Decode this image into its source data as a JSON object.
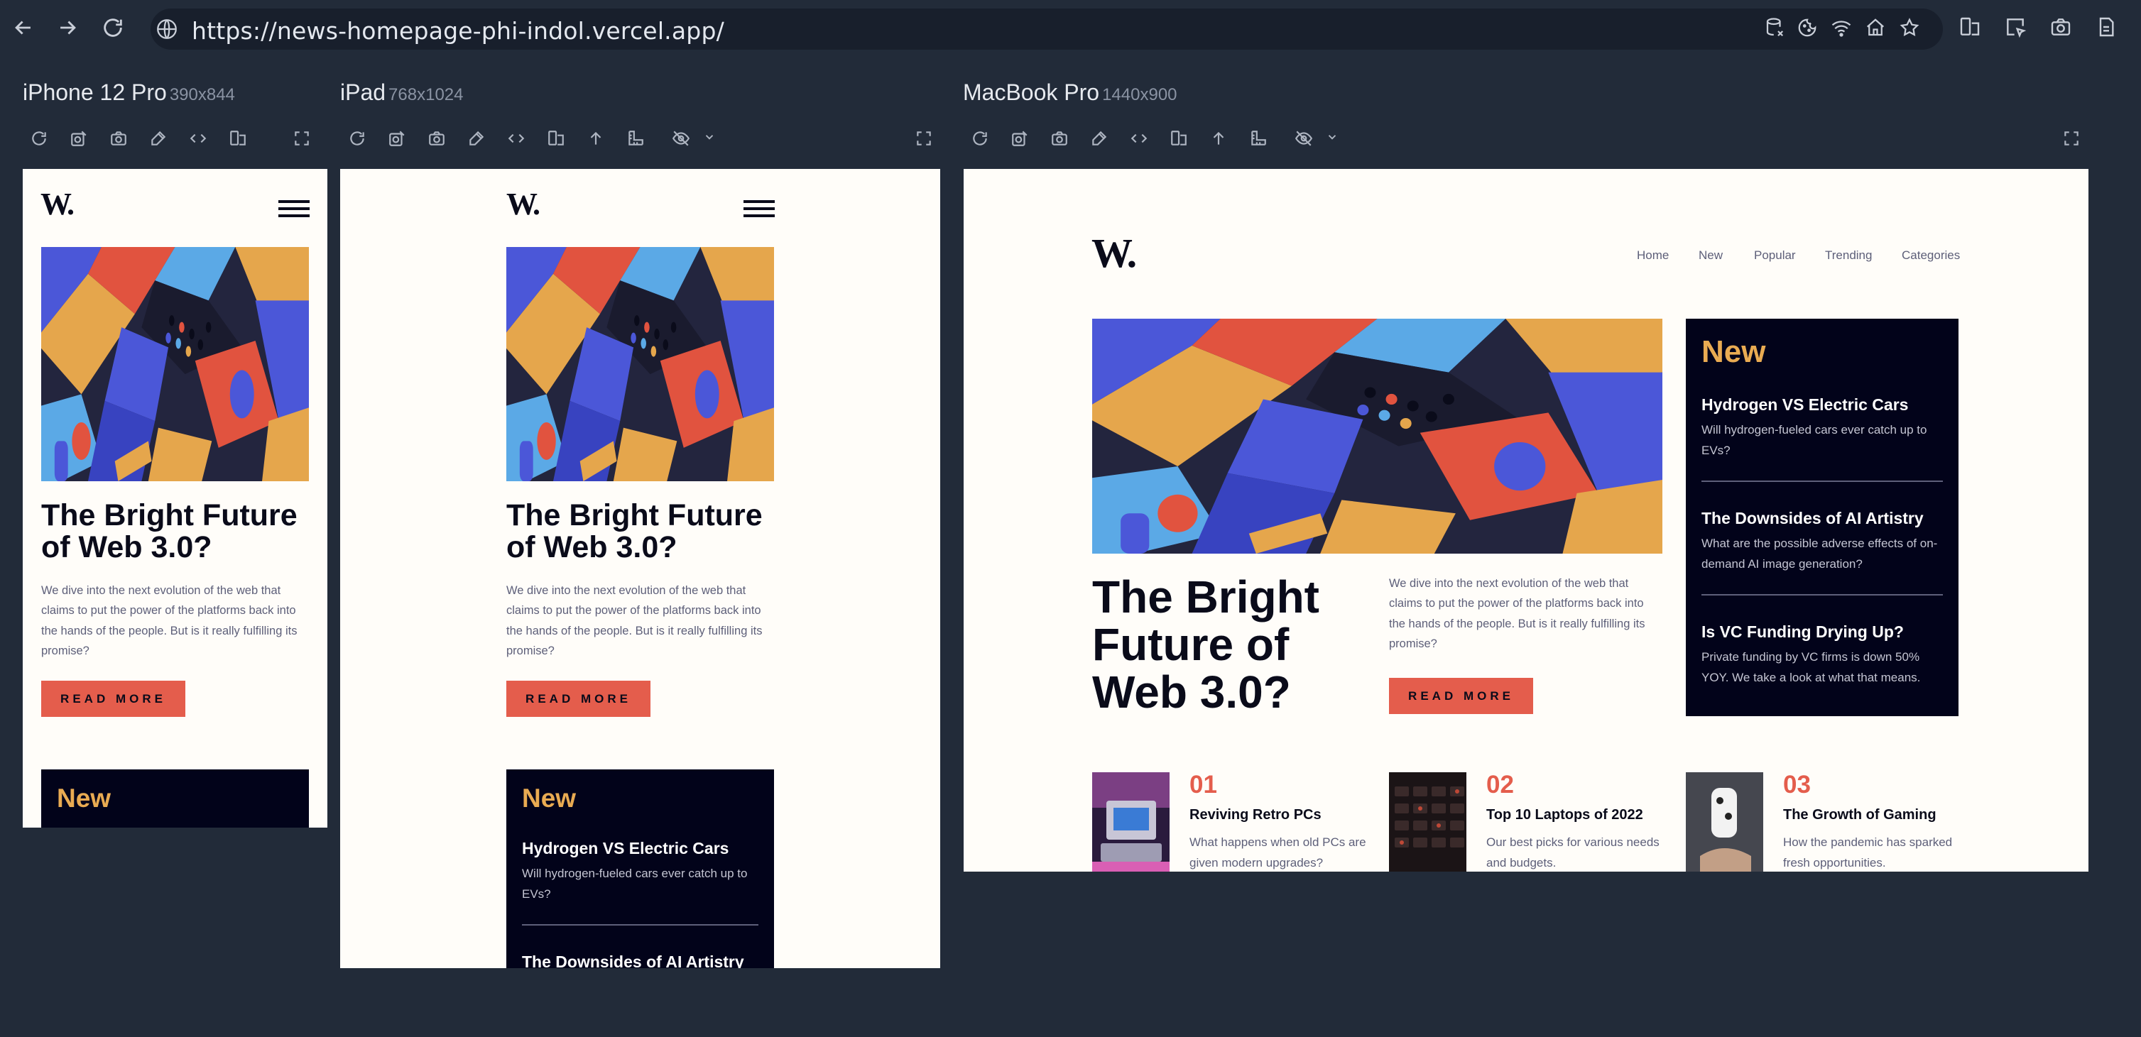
{
  "browser": {
    "url": "https://news-homepage-phi-indol.vercel.app/"
  },
  "devices": [
    {
      "name": "iPhone 12 Pro",
      "resolution": "390x844"
    },
    {
      "name": "iPad",
      "resolution": "768x1024"
    },
    {
      "name": "MacBook Pro",
      "resolution": "1440x900"
    }
  ],
  "site": {
    "logo": "W.",
    "nav": [
      "Home",
      "New",
      "Popular",
      "Trending",
      "Categories"
    ],
    "hero": {
      "title": "The Bright Future of Web 3.0?",
      "text": "We dive into the next evolution of the web that claims to put the power of the platforms back into the hands of the people. But is it really fulfilling its promise?",
      "button": "READ MORE"
    },
    "new": {
      "heading": "New",
      "items": [
        {
          "title": "Hydrogen VS Electric Cars",
          "desc": "Will hydrogen-fueled cars ever catch up to EVs?"
        },
        {
          "title": "The Downsides of AI Artistry",
          "desc": "What are the possible adverse effects of on-demand AI image generation?"
        },
        {
          "title": "Is VC Funding Drying Up?",
          "desc": "Private funding by VC firms is down 50% YOY. We take a look at what that means."
        }
      ]
    },
    "cards": [
      {
        "num": "01",
        "title": "Reviving Retro PCs",
        "desc": "What happens when old PCs are given modern upgrades?"
      },
      {
        "num": "02",
        "title": "Top 10 Laptops of 2022",
        "desc": "Our best picks for various needs and budgets."
      },
      {
        "num": "03",
        "title": "The Growth of Gaming",
        "desc": "How the pandemic has sparked fresh opportunities."
      }
    ]
  },
  "colors": {
    "page_bg": "#222b39",
    "site_bg": "#fffdf9",
    "accent_red": "#e45d4c",
    "accent_gold": "#e9ab52",
    "dark_navy": "#02031a"
  }
}
